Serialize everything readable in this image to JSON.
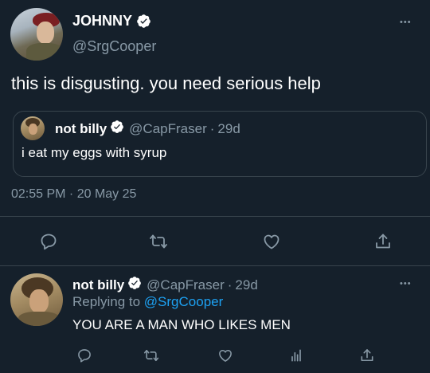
{
  "main_tweet": {
    "display_name": "JOHNNY",
    "handle": "@SrgCooper",
    "text": "this is disgusting. you need serious help",
    "timestamp": "02:55 PM · 20 May 25",
    "quoted": {
      "display_name": "not billy",
      "handle": "@CapFraser",
      "separator": "·",
      "age": "29d",
      "text": "i eat my eggs with syrup"
    }
  },
  "reply": {
    "display_name": "not billy",
    "handle": "@CapFraser",
    "separator": "·",
    "age": "29d",
    "replying_prefix": "Replying to",
    "replying_handle": "@SrgCooper",
    "text": "YOU ARE A MAN WHO LIKES MEN"
  },
  "more_label": "•••",
  "colors": {
    "background": "#15202b",
    "muted_text": "#8899a6",
    "divider": "#38444d",
    "link": "#1da1f2",
    "verified_badge": "#ffffff"
  },
  "icons": [
    "verified-badge-icon",
    "more-icon",
    "reply-icon",
    "retweet-icon",
    "like-icon",
    "share-icon",
    "analytics-icon"
  ]
}
